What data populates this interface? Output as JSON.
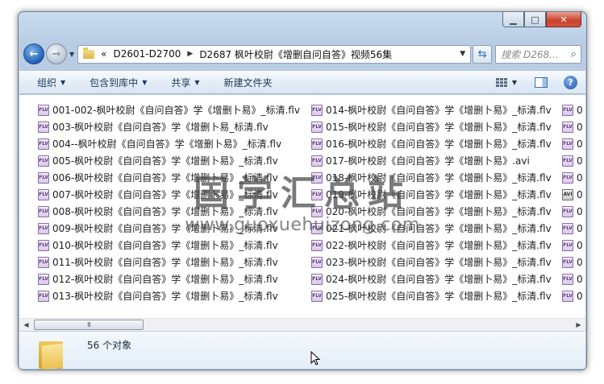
{
  "nav": {
    "breadcrumb_prefix": "«",
    "breadcrumb": [
      "D2601-D2700",
      "D2687 枫叶校尉《增删自问自答》视频56集"
    ],
    "search_placeholder": "搜索 D268..."
  },
  "toolbar": {
    "organize": "组织",
    "include_in_library": "包含到库中",
    "share": "共享",
    "new_folder": "新建文件夹"
  },
  "files": {
    "col1": [
      {
        "name": "001-002-枫叶校尉《自问自答》学《增删卜易》_标清.flv",
        "icon": "flv"
      },
      {
        "name": "003-枫叶校尉《自问自答》学《增删卜易_标清.flv",
        "icon": "flv"
      },
      {
        "name": "004--枫叶校尉《自问自答》学《增删卜易》_标清.flv",
        "icon": "flv"
      },
      {
        "name": "005-枫叶校尉《自问自答》学《增删卜易》_标清.flv",
        "icon": "flv"
      },
      {
        "name": "006-枫叶校尉《自问自答》学《增删卜易》_标清.flv",
        "icon": "flv"
      },
      {
        "name": "007-枫叶校尉《自问自答》学《增删卜易》_标清.flv",
        "icon": "flv"
      },
      {
        "name": "008-枫叶校尉《自问自答》学《增删卜易》_标清.flv",
        "icon": "flv"
      },
      {
        "name": "009-枫叶校尉《自问自答》学《增删卜易》_标清.flv",
        "icon": "flv"
      },
      {
        "name": "010-枫叶校尉《自问自答》学《增删卜易》_标清.flv",
        "icon": "flv"
      },
      {
        "name": "011-枫叶校尉《自问自答》学《增删卜易》_标清.flv",
        "icon": "flv"
      },
      {
        "name": "012-枫叶校尉《自问自答》学《增删卜易》_标清.flv",
        "icon": "flv"
      },
      {
        "name": "013-枫叶校尉《自问自答》学《增删卜易》_标清.flv",
        "icon": "flv"
      }
    ],
    "col2": [
      {
        "name": "014-枫叶校尉《自问自答》学《增删卜易》_标清.flv",
        "icon": "flv"
      },
      {
        "name": "015-枫叶校尉《自问自答》学《增删卜易》_标清.flv",
        "icon": "flv"
      },
      {
        "name": "016-枫叶校尉《自问自答》学《增删卜易》_标清.flv",
        "icon": "flv"
      },
      {
        "name": "017-枫叶校尉《自问自答》学《增删卜易》.avi",
        "icon": "flv"
      },
      {
        "name": "018-枫叶校尉《自问自答》学《增删卜易》_标清.flv",
        "icon": "flv"
      },
      {
        "name": "019-枫叶校尉《自问自答》学《增删卜易》_标清.flv",
        "icon": "flv"
      },
      {
        "name": "020-枫叶校尉《自问自答》学《增删卜易》_标清.flv",
        "icon": "flv"
      },
      {
        "name": "021-枫叶校尉《自问自答》学《增删卜易》_标清.flv",
        "icon": "flv"
      },
      {
        "name": "022-枫叶校尉《自问自答》学《增删卜易》_标清.flv",
        "icon": "flv"
      },
      {
        "name": "023-枫叶校尉《自问自答》学《增删卜易》_标清.flv",
        "icon": "flv"
      },
      {
        "name": "024-枫叶校尉《自问自答》学《增删卜易》_标清.flv",
        "icon": "flv"
      },
      {
        "name": "025-枫叶校尉《自问自答》学《增删卜易》_标清.flv",
        "icon": "flv"
      }
    ],
    "col3": [
      {
        "name": "0",
        "icon": "flv"
      },
      {
        "name": "0",
        "icon": "flv"
      },
      {
        "name": "0",
        "icon": "flv"
      },
      {
        "name": "0",
        "icon": "flv"
      },
      {
        "name": "0",
        "icon": "flv"
      },
      {
        "name": "0",
        "icon": "avi"
      },
      {
        "name": "0",
        "icon": "flv"
      },
      {
        "name": "0",
        "icon": "flv"
      },
      {
        "name": "0",
        "icon": "flv"
      },
      {
        "name": "0",
        "icon": "flv"
      },
      {
        "name": "0",
        "icon": "flv"
      },
      {
        "name": "0",
        "icon": "flv"
      }
    ]
  },
  "watermark": {
    "title": "国学汇总站",
    "url": "www.guoxuehuizong.com"
  },
  "status": {
    "item_count": "56 个对象"
  }
}
